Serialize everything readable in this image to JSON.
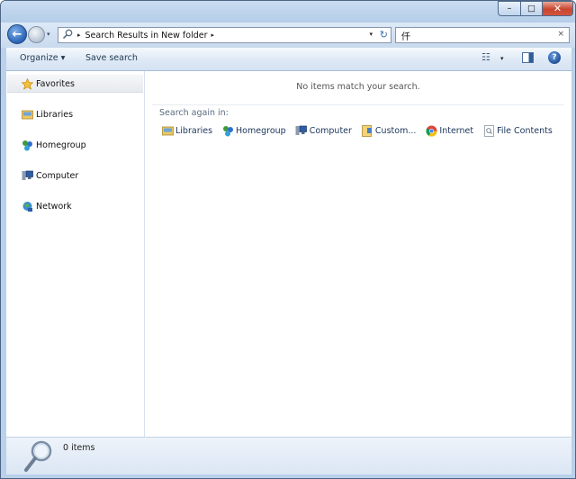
{
  "window": {
    "close_glyph": "✕",
    "maximize_glyph": "□",
    "minimize_glyph": "–"
  },
  "navbar": {
    "back_glyph": "←",
    "breadcrumb": "Search Results in New folder",
    "breadcrumb_sep": "▸",
    "dropdown_glyph": "▾",
    "refresh_glyph": "↻",
    "search_value": "仟",
    "search_clear": "×"
  },
  "cmdbar": {
    "organize": "Organize ▾",
    "save_search": "Save search",
    "views_glyph": "☷",
    "views_dd": "▾",
    "help_glyph": "?"
  },
  "navpane": {
    "favorites": "Favorites",
    "libraries": "Libraries",
    "homegroup": "Homegroup",
    "computer": "Computer",
    "network": "Network"
  },
  "content": {
    "empty_message": "No items match your search.",
    "search_again_label": "Search again in:",
    "search_again_items": [
      "Libraries",
      "Homegroup",
      "Computer",
      "Custom...",
      "Internet",
      "File Contents"
    ]
  },
  "details": {
    "count": "0 items"
  },
  "colors": {
    "frame": "#b9d1ea",
    "link": "#1a355b"
  }
}
